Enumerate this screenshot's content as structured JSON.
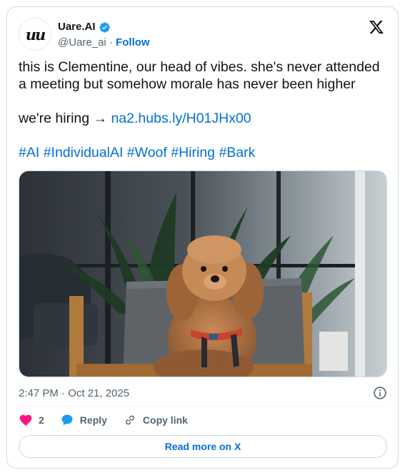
{
  "author": {
    "display_name": "Uare.AI",
    "handle": "@Uare_ai",
    "separator": "·",
    "follow_label": "Follow",
    "avatar_text": "u"
  },
  "post": {
    "line1": "this is Clementine, our head of vibes. she's never attended a meeting but somehow morale has never been higher",
    "hiring_text": "we're hiring →",
    "link_text": "na2.hubs.ly/H01JHx00",
    "hashtags": [
      "#AI",
      "#IndividualAI",
      "#Woof",
      "#Hiring",
      "#Bark"
    ]
  },
  "meta": {
    "timestamp": "2:47 PM · Oct 21, 2025"
  },
  "actions": {
    "like_count": "2",
    "reply_label": "Reply",
    "copy_label": "Copy link"
  },
  "footer": {
    "read_more_label": "Read more on X"
  },
  "colors": {
    "link": "#006fd6",
    "verified": "#1d9bf0",
    "like": "#f91880",
    "muted": "#536471"
  },
  "icons": [
    "verified-badge-icon",
    "x-logo-icon",
    "info-icon",
    "heart-icon",
    "reply-bubble-icon",
    "link-icon"
  ]
}
